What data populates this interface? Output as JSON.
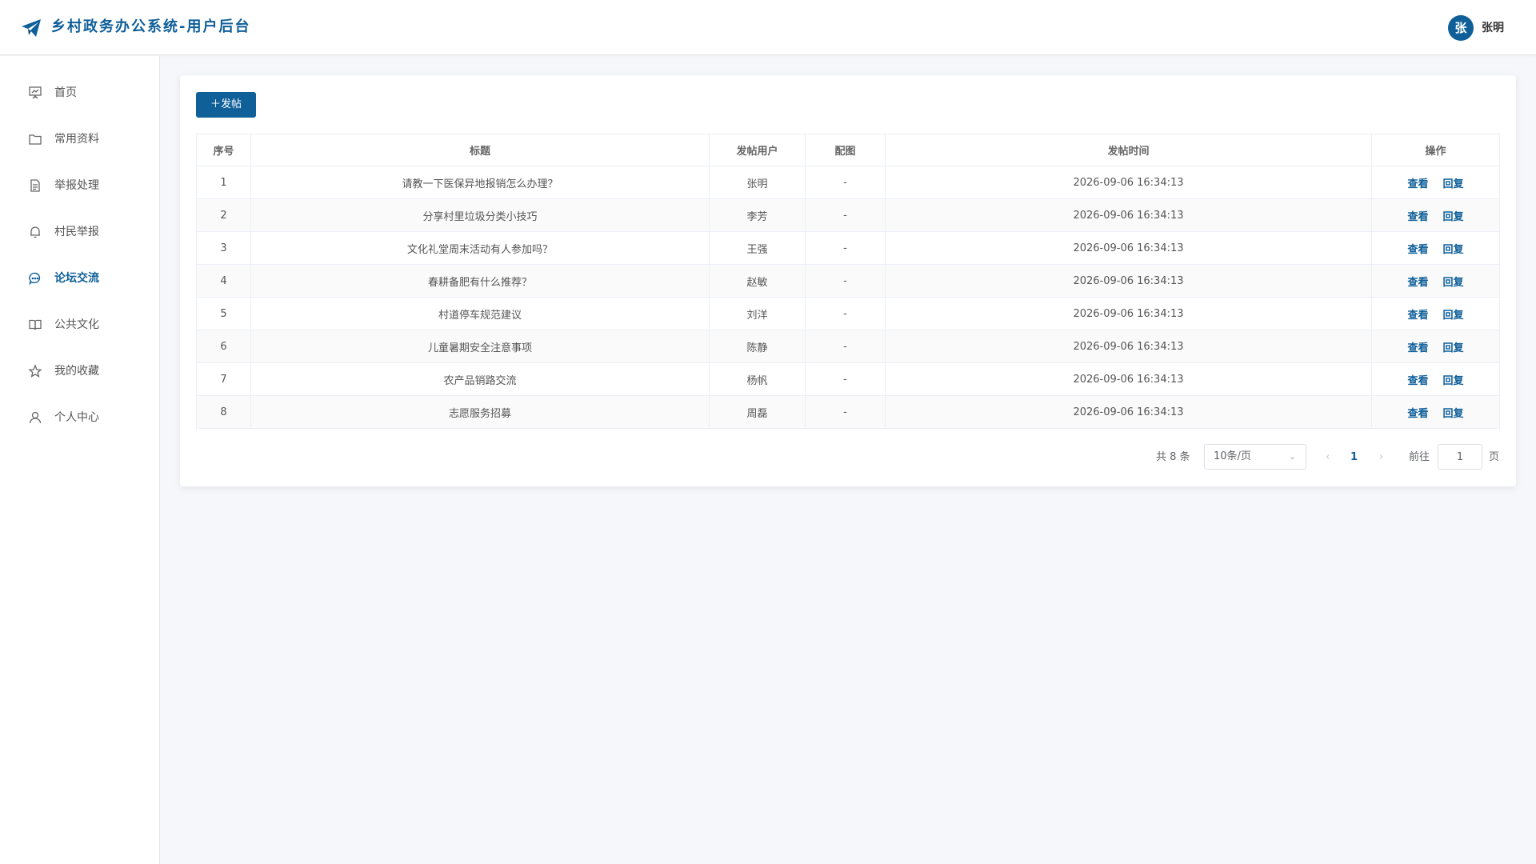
{
  "header": {
    "title": "乡村政务办公系统-用户后台",
    "avatar_text": "张",
    "user_name": "张明",
    "brand_color": "#0f5f99"
  },
  "sidebar": {
    "items": [
      {
        "label": "首页",
        "icon": "presentation-icon"
      },
      {
        "label": "常用资料",
        "icon": "folder-icon"
      },
      {
        "label": "举报处理",
        "icon": "document-icon"
      },
      {
        "label": "村民举报",
        "icon": "bell-icon"
      },
      {
        "label": "论坛交流",
        "icon": "chat-icon",
        "active": true
      },
      {
        "label": "公共文化",
        "icon": "book-icon"
      },
      {
        "label": "我的收藏",
        "icon": "star-icon"
      },
      {
        "label": "个人中心",
        "icon": "user-icon"
      }
    ]
  },
  "toolbar": {
    "post_button": "＋发帖"
  },
  "table": {
    "headers": [
      "序号",
      "标题",
      "发帖用户",
      "配图",
      "发帖时间",
      "操作"
    ],
    "rows": [
      {
        "index": "1",
        "title": "请教一下医保异地报销怎么办理？",
        "user": "张明",
        "image": "-",
        "time": "2026-09-06 16:34:13"
      },
      {
        "index": "2",
        "title": "分享村里垃圾分类小技巧",
        "user": "李芳",
        "image": "-",
        "time": "2026-09-06 16:34:13"
      },
      {
        "index": "3",
        "title": "文化礼堂周末活动有人参加吗？",
        "user": "王强",
        "image": "-",
        "time": "2026-09-06 16:34:13"
      },
      {
        "index": "4",
        "title": "春耕备肥有什么推荐？",
        "user": "赵敏",
        "image": "-",
        "time": "2026-09-06 16:34:13"
      },
      {
        "index": "5",
        "title": "村道停车规范建议",
        "user": "刘洋",
        "image": "-",
        "time": "2026-09-06 16:34:13"
      },
      {
        "index": "6",
        "title": "儿童暑期安全注意事项",
        "user": "陈静",
        "image": "-",
        "time": "2026-09-06 16:34:13"
      },
      {
        "index": "7",
        "title": "农产品销路交流",
        "user": "杨帆",
        "image": "-",
        "time": "2026-09-06 16:34:13"
      },
      {
        "index": "8",
        "title": "志愿服务招募",
        "user": "周磊",
        "image": "-",
        "time": "2026-09-06 16:34:13"
      }
    ],
    "actions": {
      "view": "查看",
      "reply": "回复"
    }
  },
  "pagination": {
    "total_text": "共 8 条",
    "page_size": "10条/页",
    "prev": "‹",
    "current_page": "1",
    "next": "›",
    "goto_label": "前往",
    "goto_value": "1",
    "page_unit": "页"
  }
}
